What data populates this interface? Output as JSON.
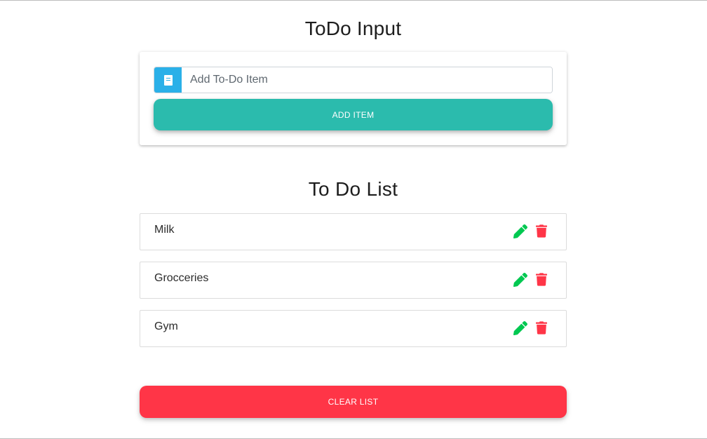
{
  "input_section": {
    "title": "ToDo Input",
    "input": {
      "placeholder": "Add To-Do Item",
      "value": "",
      "icon": "book-icon"
    },
    "add_button_label": "ADD ITEM"
  },
  "list_section": {
    "title": "To Do List",
    "items": [
      {
        "text": "Milk",
        "edit_icon": "pencil-icon",
        "delete_icon": "trash-icon"
      },
      {
        "text": "Grocceries",
        "edit_icon": "pencil-icon",
        "delete_icon": "trash-icon"
      },
      {
        "text": "Gym",
        "edit_icon": "pencil-icon",
        "delete_icon": "trash-icon"
      }
    ],
    "clear_button_label": "CLEAR LIST"
  },
  "colors": {
    "input_icon_bg": "#2ab0e8",
    "add_button": "#2bbbad",
    "clear_button": "#ff3547",
    "edit_icon": "#00c851",
    "delete_icon": "#ff3547"
  }
}
